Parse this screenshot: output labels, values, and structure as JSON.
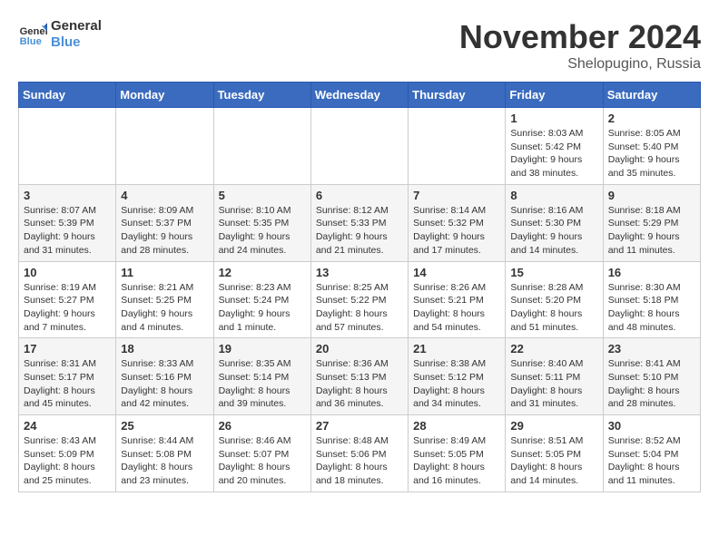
{
  "logo": {
    "line1": "General",
    "line2": "Blue"
  },
  "title": "November 2024",
  "location": "Shelopugino, Russia",
  "days_of_week": [
    "Sunday",
    "Monday",
    "Tuesday",
    "Wednesday",
    "Thursday",
    "Friday",
    "Saturday"
  ],
  "weeks": [
    [
      {
        "num": "",
        "info": ""
      },
      {
        "num": "",
        "info": ""
      },
      {
        "num": "",
        "info": ""
      },
      {
        "num": "",
        "info": ""
      },
      {
        "num": "",
        "info": ""
      },
      {
        "num": "1",
        "info": "Sunrise: 8:03 AM\nSunset: 5:42 PM\nDaylight: 9 hours\nand 38 minutes."
      },
      {
        "num": "2",
        "info": "Sunrise: 8:05 AM\nSunset: 5:40 PM\nDaylight: 9 hours\nand 35 minutes."
      }
    ],
    [
      {
        "num": "3",
        "info": "Sunrise: 8:07 AM\nSunset: 5:39 PM\nDaylight: 9 hours\nand 31 minutes."
      },
      {
        "num": "4",
        "info": "Sunrise: 8:09 AM\nSunset: 5:37 PM\nDaylight: 9 hours\nand 28 minutes."
      },
      {
        "num": "5",
        "info": "Sunrise: 8:10 AM\nSunset: 5:35 PM\nDaylight: 9 hours\nand 24 minutes."
      },
      {
        "num": "6",
        "info": "Sunrise: 8:12 AM\nSunset: 5:33 PM\nDaylight: 9 hours\nand 21 minutes."
      },
      {
        "num": "7",
        "info": "Sunrise: 8:14 AM\nSunset: 5:32 PM\nDaylight: 9 hours\nand 17 minutes."
      },
      {
        "num": "8",
        "info": "Sunrise: 8:16 AM\nSunset: 5:30 PM\nDaylight: 9 hours\nand 14 minutes."
      },
      {
        "num": "9",
        "info": "Sunrise: 8:18 AM\nSunset: 5:29 PM\nDaylight: 9 hours\nand 11 minutes."
      }
    ],
    [
      {
        "num": "10",
        "info": "Sunrise: 8:19 AM\nSunset: 5:27 PM\nDaylight: 9 hours\nand 7 minutes."
      },
      {
        "num": "11",
        "info": "Sunrise: 8:21 AM\nSunset: 5:25 PM\nDaylight: 9 hours\nand 4 minutes."
      },
      {
        "num": "12",
        "info": "Sunrise: 8:23 AM\nSunset: 5:24 PM\nDaylight: 9 hours\nand 1 minute."
      },
      {
        "num": "13",
        "info": "Sunrise: 8:25 AM\nSunset: 5:22 PM\nDaylight: 8 hours\nand 57 minutes."
      },
      {
        "num": "14",
        "info": "Sunrise: 8:26 AM\nSunset: 5:21 PM\nDaylight: 8 hours\nand 54 minutes."
      },
      {
        "num": "15",
        "info": "Sunrise: 8:28 AM\nSunset: 5:20 PM\nDaylight: 8 hours\nand 51 minutes."
      },
      {
        "num": "16",
        "info": "Sunrise: 8:30 AM\nSunset: 5:18 PM\nDaylight: 8 hours\nand 48 minutes."
      }
    ],
    [
      {
        "num": "17",
        "info": "Sunrise: 8:31 AM\nSunset: 5:17 PM\nDaylight: 8 hours\nand 45 minutes."
      },
      {
        "num": "18",
        "info": "Sunrise: 8:33 AM\nSunset: 5:16 PM\nDaylight: 8 hours\nand 42 minutes."
      },
      {
        "num": "19",
        "info": "Sunrise: 8:35 AM\nSunset: 5:14 PM\nDaylight: 8 hours\nand 39 minutes."
      },
      {
        "num": "20",
        "info": "Sunrise: 8:36 AM\nSunset: 5:13 PM\nDaylight: 8 hours\nand 36 minutes."
      },
      {
        "num": "21",
        "info": "Sunrise: 8:38 AM\nSunset: 5:12 PM\nDaylight: 8 hours\nand 34 minutes."
      },
      {
        "num": "22",
        "info": "Sunrise: 8:40 AM\nSunset: 5:11 PM\nDaylight: 8 hours\nand 31 minutes."
      },
      {
        "num": "23",
        "info": "Sunrise: 8:41 AM\nSunset: 5:10 PM\nDaylight: 8 hours\nand 28 minutes."
      }
    ],
    [
      {
        "num": "24",
        "info": "Sunrise: 8:43 AM\nSunset: 5:09 PM\nDaylight: 8 hours\nand 25 minutes."
      },
      {
        "num": "25",
        "info": "Sunrise: 8:44 AM\nSunset: 5:08 PM\nDaylight: 8 hours\nand 23 minutes."
      },
      {
        "num": "26",
        "info": "Sunrise: 8:46 AM\nSunset: 5:07 PM\nDaylight: 8 hours\nand 20 minutes."
      },
      {
        "num": "27",
        "info": "Sunrise: 8:48 AM\nSunset: 5:06 PM\nDaylight: 8 hours\nand 18 minutes."
      },
      {
        "num": "28",
        "info": "Sunrise: 8:49 AM\nSunset: 5:05 PM\nDaylight: 8 hours\nand 16 minutes."
      },
      {
        "num": "29",
        "info": "Sunrise: 8:51 AM\nSunset: 5:05 PM\nDaylight: 8 hours\nand 14 minutes."
      },
      {
        "num": "30",
        "info": "Sunrise: 8:52 AM\nSunset: 5:04 PM\nDaylight: 8 hours\nand 11 minutes."
      }
    ]
  ]
}
